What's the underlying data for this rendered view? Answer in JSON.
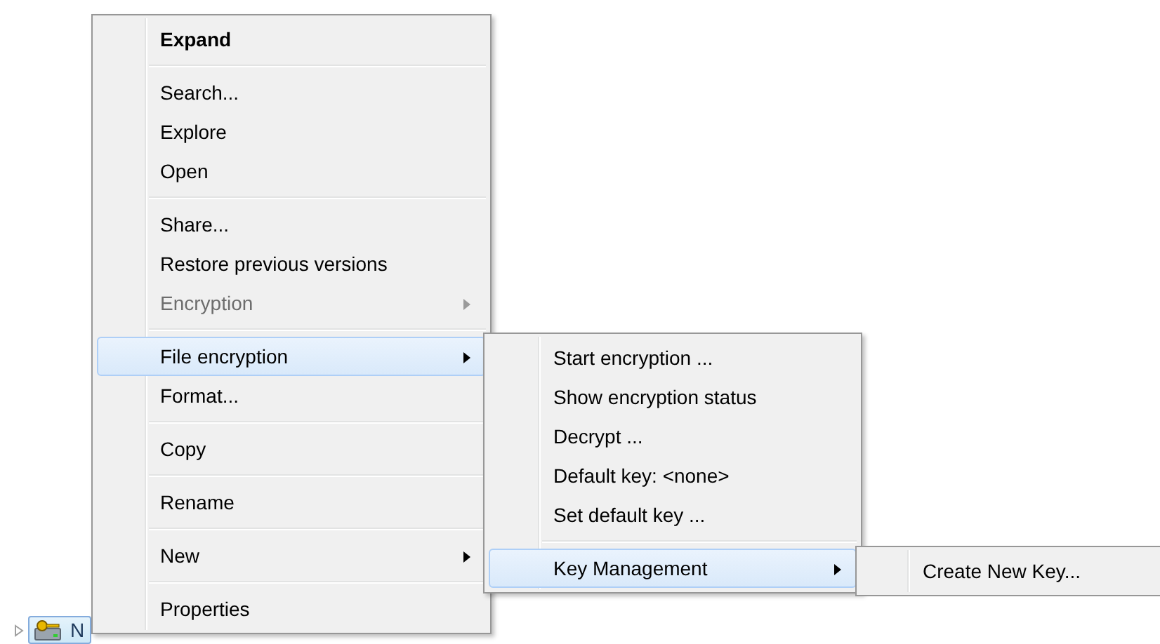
{
  "tree_item": {
    "label": "N",
    "selected": true
  },
  "context_menu": {
    "items": [
      {
        "kind": "item",
        "label": "Expand",
        "bold": true,
        "disabled": false,
        "selected": false,
        "has_submenu": false
      },
      {
        "kind": "separator"
      },
      {
        "kind": "item",
        "label": "Search...",
        "bold": false,
        "disabled": false,
        "selected": false,
        "has_submenu": false
      },
      {
        "kind": "item",
        "label": "Explore",
        "bold": false,
        "disabled": false,
        "selected": false,
        "has_submenu": false
      },
      {
        "kind": "item",
        "label": "Open",
        "bold": false,
        "disabled": false,
        "selected": false,
        "has_submenu": false
      },
      {
        "kind": "separator"
      },
      {
        "kind": "item",
        "label": "Share...",
        "bold": false,
        "disabled": false,
        "selected": false,
        "has_submenu": false
      },
      {
        "kind": "item",
        "label": "Restore previous versions",
        "bold": false,
        "disabled": false,
        "selected": false,
        "has_submenu": false
      },
      {
        "kind": "item",
        "label": "Encryption",
        "bold": false,
        "disabled": true,
        "selected": false,
        "has_submenu": true
      },
      {
        "kind": "separator"
      },
      {
        "kind": "item",
        "label": "File encryption",
        "bold": false,
        "disabled": false,
        "selected": true,
        "has_submenu": true,
        "submenu": {
          "items": [
            {
              "kind": "item",
              "label": "Start encryption ...",
              "bold": false,
              "disabled": false,
              "selected": false,
              "has_submenu": false
            },
            {
              "kind": "item",
              "label": "Show encryption status",
              "bold": false,
              "disabled": false,
              "selected": false,
              "has_submenu": false
            },
            {
              "kind": "item",
              "label": "Decrypt ...",
              "bold": false,
              "disabled": false,
              "selected": false,
              "has_submenu": false
            },
            {
              "kind": "item",
              "label": "Default key: <none>",
              "bold": false,
              "disabled": false,
              "selected": false,
              "has_submenu": false
            },
            {
              "kind": "item",
              "label": "Set default key ...",
              "bold": false,
              "disabled": false,
              "selected": false,
              "has_submenu": false
            },
            {
              "kind": "separator"
            },
            {
              "kind": "item",
              "label": "Key Management",
              "bold": false,
              "disabled": false,
              "selected": true,
              "has_submenu": true,
              "submenu": {
                "items": [
                  {
                    "kind": "item",
                    "label": "Create New Key...",
                    "bold": false,
                    "disabled": false,
                    "selected": false,
                    "has_submenu": false
                  }
                ]
              }
            }
          ]
        }
      },
      {
        "kind": "item",
        "label": "Format...",
        "bold": false,
        "disabled": false,
        "selected": false,
        "has_submenu": false
      },
      {
        "kind": "separator"
      },
      {
        "kind": "item",
        "label": "Copy",
        "bold": false,
        "disabled": false,
        "selected": false,
        "has_submenu": false
      },
      {
        "kind": "separator"
      },
      {
        "kind": "item",
        "label": "Rename",
        "bold": false,
        "disabled": false,
        "selected": false,
        "has_submenu": false
      },
      {
        "kind": "separator"
      },
      {
        "kind": "item",
        "label": "New",
        "bold": false,
        "disabled": false,
        "selected": false,
        "has_submenu": true
      },
      {
        "kind": "separator"
      },
      {
        "kind": "item",
        "label": "Properties",
        "bold": false,
        "disabled": false,
        "selected": false,
        "has_submenu": false
      }
    ]
  }
}
